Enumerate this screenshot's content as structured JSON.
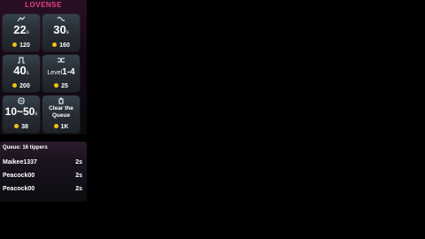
{
  "brand": "LOVENSE",
  "colors": {
    "accent": "#e43f88",
    "token": "#f3c21b"
  },
  "tiles": [
    {
      "icon": "pulse-icon",
      "value": "22",
      "unit": "s",
      "tokens": "120"
    },
    {
      "icon": "wave-icon",
      "value": "30",
      "unit": "s",
      "tokens": "160"
    },
    {
      "icon": "square-wave-icon",
      "value": "40",
      "unit": "s",
      "tokens": "200"
    },
    {
      "icon": "random-icon",
      "prefix": "Level",
      "value": "1-4",
      "tokens": "25"
    },
    {
      "icon": "control-icon",
      "value": "10~50",
      "unit": "s",
      "tokens": "38"
    },
    {
      "icon": "clear-queue-icon",
      "label": "Clear the Queue",
      "tokens": "1K"
    }
  ],
  "queue": {
    "title": "Queue: 16 tippers",
    "rows": [
      {
        "name": "Maikee1337",
        "time": "2s"
      },
      {
        "name": "Peacock00",
        "time": "2s"
      },
      {
        "name": "Peacock00",
        "time": "2s"
      }
    ]
  }
}
